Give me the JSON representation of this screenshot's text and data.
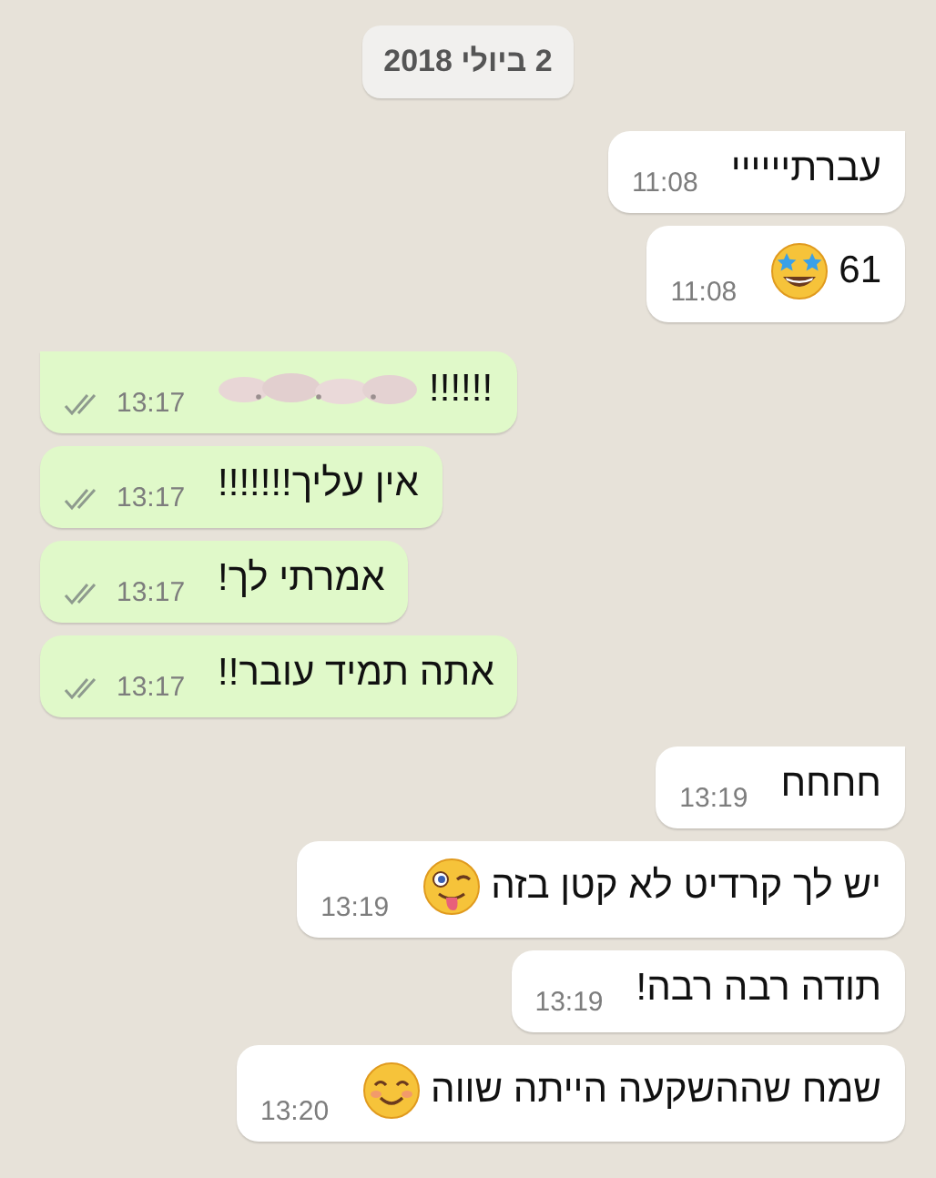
{
  "date_chip": "2 ביולי 2018",
  "messages": [
    {
      "kind": "incoming",
      "tail": true,
      "text": "עברתיייייי",
      "time": "11:08"
    },
    {
      "kind": "incoming",
      "tail": false,
      "text": "61",
      "emoji": {
        "kind": "starstruck"
      },
      "time": "11:08"
    },
    {
      "kind": "outgoing",
      "tail": true,
      "text": "!!!!!!",
      "redacted": true,
      "time": "13:17",
      "read": false
    },
    {
      "kind": "outgoing",
      "tail": false,
      "text": "אין עליך!!!!!!!",
      "time": "13:17",
      "read": false
    },
    {
      "kind": "outgoing",
      "tail": false,
      "text": "אמרתי לך!",
      "time": "13:17",
      "read": false
    },
    {
      "kind": "outgoing",
      "tail": false,
      "text": "אתה תמיד עובר!!",
      "time": "13:17",
      "read": false
    },
    {
      "kind": "incoming",
      "tail": true,
      "text": "חחחח",
      "time": "13:19"
    },
    {
      "kind": "incoming",
      "tail": false,
      "text": "יש לך קרדיט לא קטן בזה",
      "emoji": {
        "kind": "wink_tongue"
      },
      "time": "13:19"
    },
    {
      "kind": "incoming",
      "tail": false,
      "text": "תודה רבה רבה!",
      "time": "13:19"
    },
    {
      "kind": "incoming",
      "tail": false,
      "text": "שמח שההשקעה הייתה שווה",
      "emoji": {
        "kind": "smile"
      },
      "time": "13:20"
    }
  ]
}
